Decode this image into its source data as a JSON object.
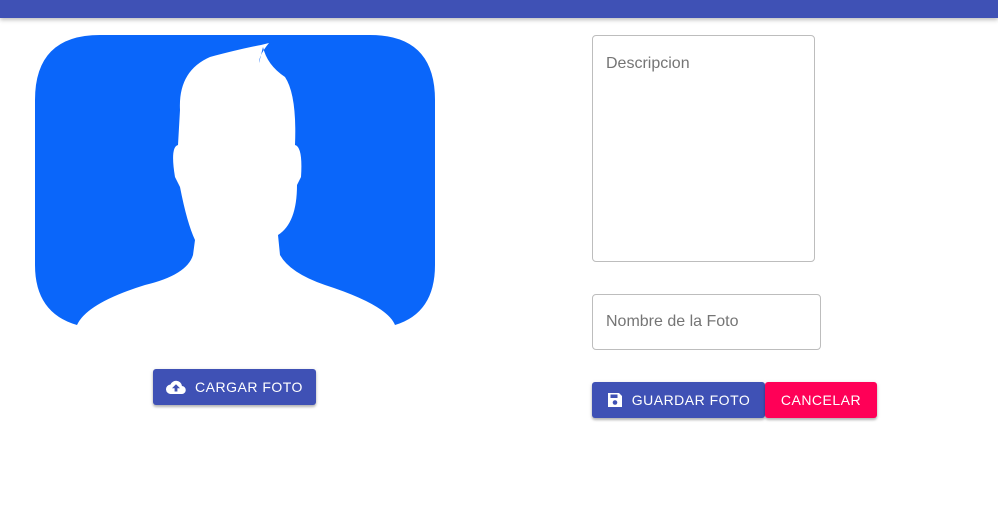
{
  "header": {
    "color": "#3f51b5"
  },
  "avatar": {
    "icon": "person-silhouette",
    "background_color": "#0a66fa"
  },
  "upload_button": {
    "label": "CARGAR FOTO",
    "icon": "cloud-upload-icon"
  },
  "form": {
    "description": {
      "placeholder": "Descripcion",
      "value": ""
    },
    "photo_name": {
      "placeholder": "Nombre de la Foto",
      "value": ""
    }
  },
  "actions": {
    "save_label": "GUARDAR FOTO",
    "save_icon": "save-icon",
    "cancel_label": "CANCELAR",
    "primary_color": "#3f51b5",
    "accent_color": "#ff0057"
  }
}
